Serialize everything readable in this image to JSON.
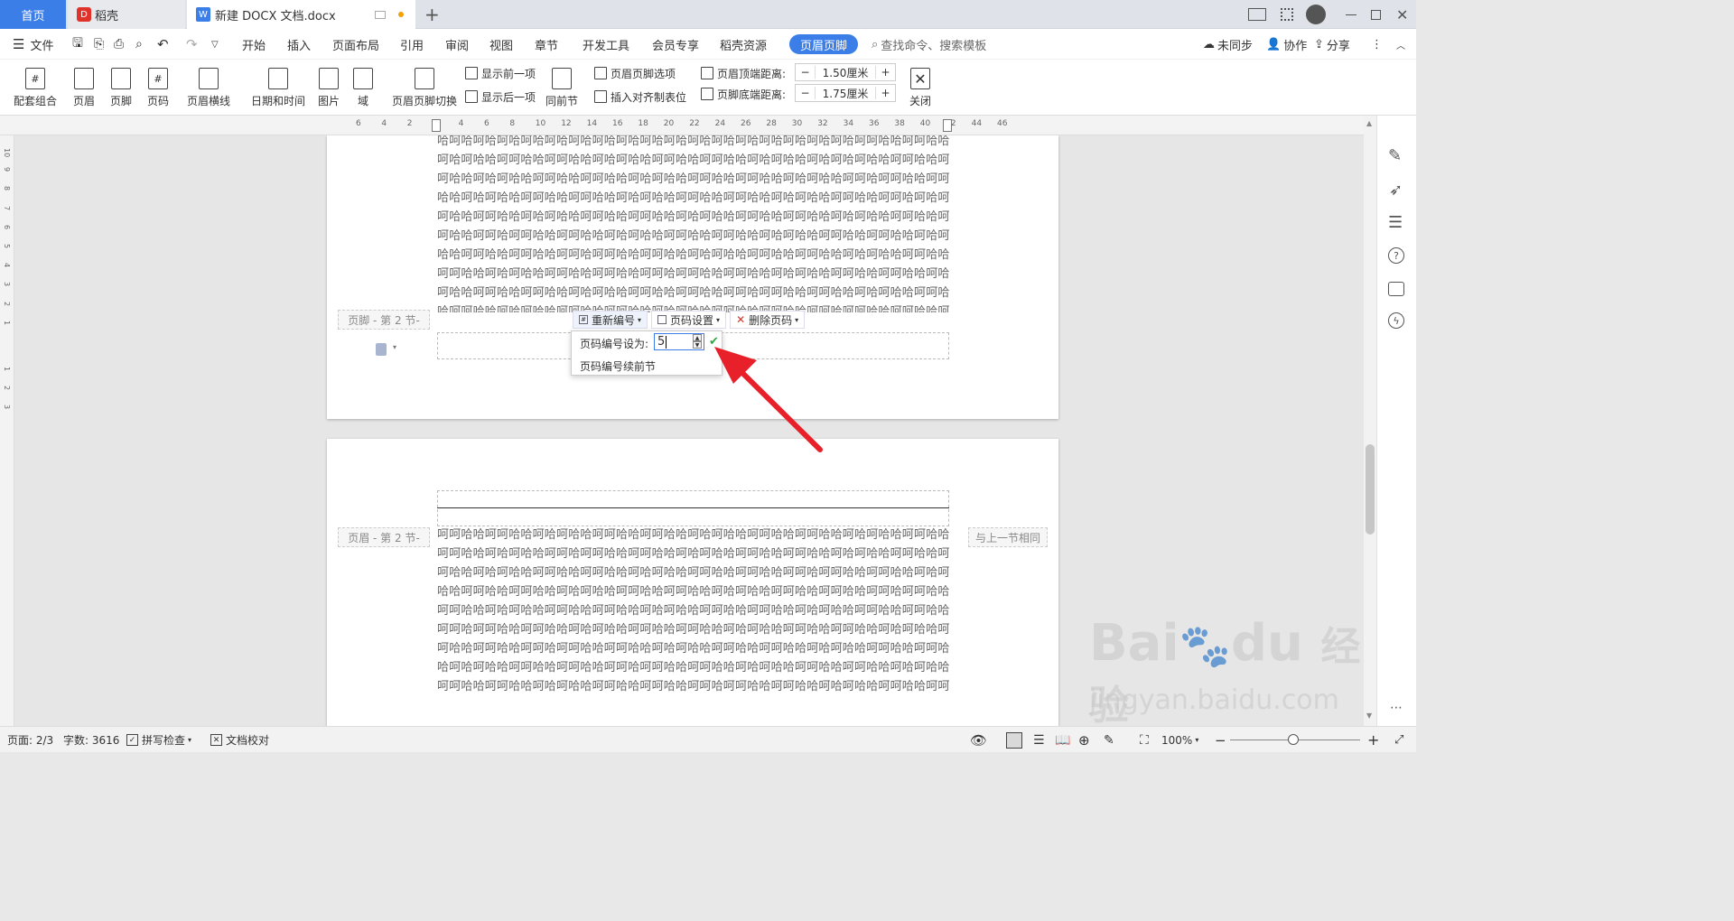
{
  "tabs": {
    "home": "首页",
    "daoke": "稻壳",
    "document": "新建 DOCX 文档.docx"
  },
  "menu": {
    "file": "文件",
    "items": [
      "开始",
      "插入",
      "页面布局",
      "引用",
      "审阅",
      "视图",
      "章节",
      "开发工具",
      "会员专享",
      "稻壳资源"
    ],
    "active": "页眉页脚",
    "search_placeholder": "查找命令、搜索模板",
    "sync": "未同步",
    "collab": "协作",
    "share": "分享"
  },
  "ribbon": {
    "combo": "配套组合",
    "header": "页眉",
    "footer": "页脚",
    "page_number": "页码",
    "header_line": "页眉横线",
    "datetime": "日期和时间",
    "picture": "图片",
    "field": "域",
    "switch": "页眉页脚切换",
    "show_prev": "显示前一项",
    "show_next": "显示后一项",
    "same_as_prev": "同前节",
    "hf_options": "页眉页脚选项",
    "insert_align_tab": "插入对齐制表位",
    "header_top_label": "页眉顶端距离:",
    "header_top_value": "1.50厘米",
    "footer_bottom_label": "页脚底端距离:",
    "footer_bottom_value": "1.75厘米",
    "close": "关闭"
  },
  "ruler_ticks": [
    "6",
    "4",
    "2",
    "2",
    "4",
    "6",
    "8",
    "10",
    "12",
    "14",
    "16",
    "18",
    "20",
    "22",
    "24",
    "26",
    "28",
    "30",
    "32",
    "34",
    "36",
    "38",
    "40",
    "42",
    "44",
    "46"
  ],
  "vruler_ticks": [
    "10",
    "9",
    "8",
    "7",
    "6",
    "5",
    "4",
    "3",
    "2",
    "1",
    "1",
    "2",
    "3"
  ],
  "page1": {
    "text": "哈呵哈呵哈呵哈呵哈呵哈呵哈呵哈呵哈呵哈呵哈呵哈呵哈呵哈呵哈呵哈呵哈呵哈呵呵哈哈呵呵哈哈呵哈呵哈哈呵呵哈哈呵呵哈哈呵哈呵哈哈呵呵哈哈呵呵哈哈呵哈呵哈哈呵哈呵哈呵哈哈呵呵哈哈呵呵哈哈呵哈呵哈哈呵呵哈哈呵呵哈哈呵哈呵哈哈呵呵哈哈呵呵哈哈呵哈呵哈哈呵呵哈呵呵哈哈呵呵哈哈呵哈呵哈哈呵呵哈哈呵呵哈哈呵哈呵哈哈呵呵哈哈呵呵哈哈呵哈呵哈哈呵呵哈哈呵呵哈呵哈呵呵哈哈呵呵哈哈呵哈呵哈哈呵呵哈哈呵呵哈哈呵哈呵哈哈呵呵哈哈呵呵哈哈呵哈呵哈哈呵呵哈哈呵呵哈哈呵呵哈呵呵哈哈呵呵哈哈呵哈呵哈哈呵呵哈哈呵呵哈哈呵哈呵哈哈呵呵哈哈呵呵哈哈呵哈呵哈哈呵呵哈哈呵呵哈哈呵呵哈呵呵哈哈呵呵哈哈呵哈呵哈哈呵呵哈哈呵呵哈哈呵哈呵哈哈呵呵哈哈呵呵哈哈呵哈呵哈哈呵呵哈哈呵呵哈哈呵呵哈呵呵哈哈呵呵哈哈呵哈呵哈哈呵呵哈哈呵呵哈哈呵哈呵哈哈呵呵哈哈呵呵哈哈呵哈呵哈哈呵呵哈哈呵呵哈哈呵呵哈呵呵哈哈呵呵哈哈呵哈呵哈哈呵呵哈哈呵呵哈哈呵哈呵哈哈呵呵哈哈呵呵哈哈呵哈呵哈哈呵呵哈哈呵呵哈哈呵呵哈呵呵哈哈呵呵哈哈呵哈呵哈哈呵呵哈哈呵呵哈哈呵哈呵哈哈呵呵哈哈呵呵哈哈呵哈呵哈哈呵呵哈哈呵呵哈哈呵呵"
  },
  "footer_tag": "页脚 - 第 2 节-",
  "header_tag": "页眉 - 第 2 节-",
  "same_as_prev_tag": "与上一节相同",
  "footer_tools": {
    "renumber": "重新编号",
    "page_settings": "页码设置",
    "delete_page_number": "删除页码"
  },
  "renumber_popup": {
    "set_label": "页码编号设为:",
    "value": "5",
    "continue_label": "页码编号续前节"
  },
  "page2": {
    "text": "呵呵哈哈呵呵哈哈呵哈呵哈哈呵呵哈哈呵呵哈哈呵哈呵哈哈呵呵哈哈呵呵哈哈呵哈呵哈哈呵呵哈哈呵呵哈哈呵哈呵哈哈呵呵哈呵呵哈哈呵呵哈哈呵哈呵哈哈呵呵哈哈呵呵哈哈呵哈呵哈哈呵呵哈哈呵呵哈哈呵哈呵哈哈呵呵哈哈呵呵哈哈呵哈呵哈哈呵呵哈哈呵呵哈哈呵呵哈呵呵哈哈呵呵哈哈呵哈呵哈哈呵呵哈哈呵呵哈哈呵哈呵哈哈呵呵哈哈呵呵哈哈呵哈呵哈哈呵呵哈哈呵呵哈哈呵呵哈呵呵哈哈呵呵哈哈呵哈呵哈哈呵呵哈哈呵呵哈哈呵哈呵哈哈呵呵哈哈呵呵哈哈呵哈呵哈哈呵呵哈哈呵呵哈哈呵呵哈呵呵哈哈呵呵哈哈呵哈呵哈哈呵呵哈哈呵呵哈哈呵哈呵哈哈呵呵哈哈呵呵哈哈呵哈呵哈哈呵呵哈哈呵呵哈哈呵呵哈呵呵哈哈呵呵哈哈呵哈呵哈哈呵呵哈哈呵呵哈哈呵哈呵哈哈呵呵哈哈呵呵哈哈呵哈呵哈哈呵呵哈哈呵呵哈哈呵呵哈呵呵哈哈呵呵哈哈呵哈呵哈哈呵呵哈哈呵呵哈哈呵哈呵哈哈呵呵哈哈呵呵哈哈呵哈呵哈哈呵呵哈哈呵呵哈哈呵呵哈呵呵哈哈呵呵哈哈呵哈呵哈哈呵呵哈哈呵呵哈哈呵哈呵哈哈呵呵哈哈呵呵哈哈呵哈呵哈哈呵呵哈呵呵哈呵哈哈呵呵哈哈呵哈呵呵哈哈呵"
  },
  "status": {
    "page": "页面: 2/3",
    "words": "字数: 3616",
    "spell": "拼写检查",
    "proof": "文档校对",
    "zoom": "100%"
  },
  "watermark": {
    "brand": "Bai",
    "brand2": "du",
    "cn": "经验",
    "url": "jingyan.baidu.com"
  },
  "colors": {
    "accent": "#3c7ee8",
    "arrow": "#e8202a",
    "check": "#2aa845"
  }
}
